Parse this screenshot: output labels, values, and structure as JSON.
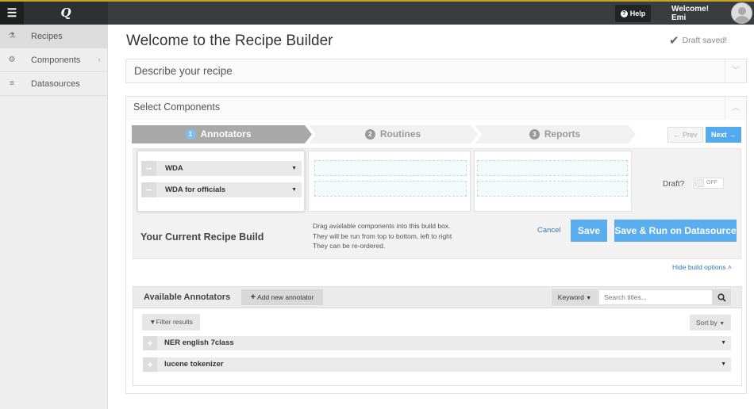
{
  "topbar": {
    "menu_icon": "hamburger-icon",
    "logo": "Q",
    "help_label": "Help",
    "welcome_line1": "Welcome!",
    "welcome_line2": "Emi"
  },
  "sidebar": {
    "items": [
      {
        "label": "Recipes",
        "icon": "flask-icon",
        "glyph": "⚗"
      },
      {
        "label": "Components",
        "icon": "cogs-icon",
        "glyph": "⚙"
      },
      {
        "label": "Datasources",
        "icon": "database-icon",
        "glyph": "≡"
      }
    ]
  },
  "page": {
    "title": "Welcome to the Recipe Builder",
    "draft_status": "Draft saved!"
  },
  "describe_panel": {
    "title": "Describe your recipe"
  },
  "components_panel": {
    "title": "Select Components"
  },
  "wizard": {
    "steps": [
      {
        "num": "1",
        "label": "Annotators"
      },
      {
        "num": "2",
        "label": "Routines"
      },
      {
        "num": "3",
        "label": "Reports"
      }
    ],
    "prev_label": "Prev",
    "next_label": "Next"
  },
  "build": {
    "column1_items": [
      "WDA",
      "WDA for officials"
    ],
    "draft_label": "Draft?",
    "toggle_label": "OFF",
    "title": "Your Current Recipe Build",
    "help_lines": [
      "Drag available components into this build box.",
      "They will be run from top to bottom, left to right",
      "They can be re-ordered."
    ],
    "cancel_label": "Cancel",
    "save_label": "Save",
    "save_run_label": "Save & Run on Datasource",
    "hide_options_label": "Hide build options"
  },
  "available": {
    "title": "Available Annotators",
    "add_label": "Add new annotator",
    "keyword_label": "Keyword",
    "search_placeholder": "Search titles...",
    "filter_label": "Filter results",
    "sort_label": "Sort by",
    "items": [
      "NER english 7class",
      "lucene tokenizer"
    ]
  }
}
